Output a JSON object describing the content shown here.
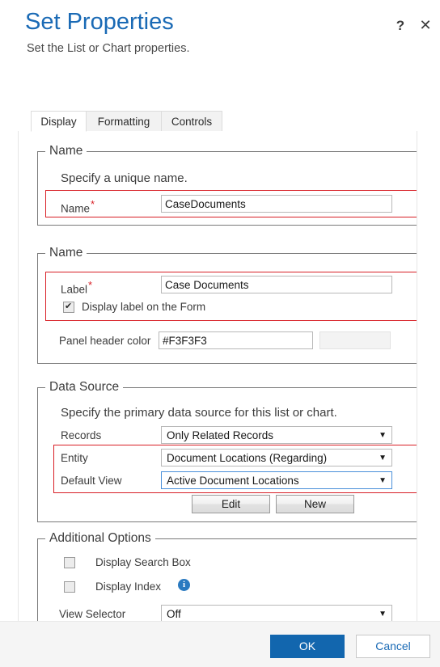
{
  "header": {
    "title": "Set Properties",
    "subtitle": "Set the List or Chart properties.",
    "help_icon": "?",
    "close_icon": "✕"
  },
  "tabs": [
    {
      "label": "Display",
      "active": true
    },
    {
      "label": "Formatting",
      "active": false
    },
    {
      "label": "Controls",
      "active": false
    }
  ],
  "sections": {
    "name_unique": {
      "legend": "Name",
      "description": "Specify a unique name.",
      "name_label": "Name",
      "name_required": "*",
      "name_value": "CaseDocuments"
    },
    "name_label_group": {
      "legend": "Name",
      "label_label": "Label",
      "label_required": "*",
      "label_value": "Case Documents",
      "display_label_checkbox": "Display label on the Form",
      "display_label_checked": true,
      "panel_header_color_label": "Panel header color",
      "panel_header_color_value": "#F3F3F3",
      "panel_header_swatch_color": "#F3F3F3"
    },
    "data_source": {
      "legend": "Data Source",
      "description": "Specify the primary data source for this list or chart.",
      "records_label": "Records",
      "records_value": "Only Related Records",
      "entity_label": "Entity",
      "entity_value": "Document Locations (Regarding)",
      "default_view_label": "Default View",
      "default_view_value": "Active Document Locations",
      "edit_button": "Edit",
      "new_button": "New",
      "dropdown_arrow": "▼"
    },
    "additional_options": {
      "legend": "Additional Options",
      "display_search_box_label": "Display Search Box",
      "display_search_box_checked": false,
      "display_index_label": "Display Index",
      "display_index_checked": false,
      "info_icon": "i",
      "view_selector_label": "View Selector",
      "view_selector_value": "Off"
    }
  },
  "footer": {
    "ok_label": "OK",
    "cancel_label": "Cancel"
  },
  "colors": {
    "title_blue": "#1A6AB5",
    "primary_button": "#1266AE",
    "required_red": "#D81F26",
    "highlight_red": "#D81F26",
    "focus_blue": "#4A90D9",
    "info_blue": "#2A7AC0"
  }
}
